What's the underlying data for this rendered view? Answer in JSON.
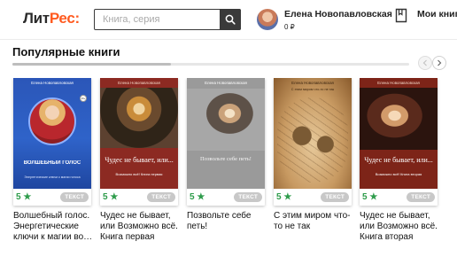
{
  "header": {
    "logo_part1": "Лит",
    "logo_part2": "Рес:",
    "search_placeholder": "Книга, серия",
    "user_name": "Елена Новопавловская",
    "user_balance": "0 ₽",
    "my_books_label": "Мои книги"
  },
  "section": {
    "title": "Популярные книги",
    "scroll_position": 0.4
  },
  "colors": {
    "brand_accent": "#ff5a1f",
    "rating_green": "#2e9c4b",
    "format_badge": "#c8c8c8"
  },
  "books": [
    {
      "cover_author": "Елена Новопавловская",
      "cover_title": "ВОЛШЕБНЫЙ ГОЛОС",
      "cover_subtitle": "Энергетические ключи к магии голоса",
      "age": "16+",
      "rating": "5",
      "format": "ТЕКСТ",
      "title": "Волшебный голос. Энергетические ключи к магии во…"
    },
    {
      "cover_author": "Елена Новопавловская",
      "cover_title": "Чудес не бывает, или...",
      "cover_subtitle": "Возможно всё! Книга первая",
      "age": "16+",
      "rating": "5",
      "format": "ТЕКСТ",
      "title": "Чудес не бывает, или Возможно всё. Книга первая"
    },
    {
      "cover_author": "Елена Новопавловская",
      "cover_title": "Позвольте себе петь!",
      "cover_subtitle": "",
      "age": "",
      "rating": "5",
      "format": "ТЕКСТ",
      "title": "Позвольте себе петь!"
    },
    {
      "cover_author": "Елена Новопавловская",
      "cover_title": "С этим миром что-то не так",
      "cover_subtitle": "",
      "age": "",
      "rating": "5",
      "format": "ТЕКСТ",
      "title": "С этим миром что-то не так"
    },
    {
      "cover_author": "Елена Новопавловская",
      "cover_title": "Чудес не бывает, или...",
      "cover_subtitle": "Возможно всё! Книга вторая",
      "age": "16+",
      "rating": "5",
      "format": "ТЕКСТ",
      "title": "Чудес не бывает, или Возможно всё. Книга вторая"
    }
  ]
}
